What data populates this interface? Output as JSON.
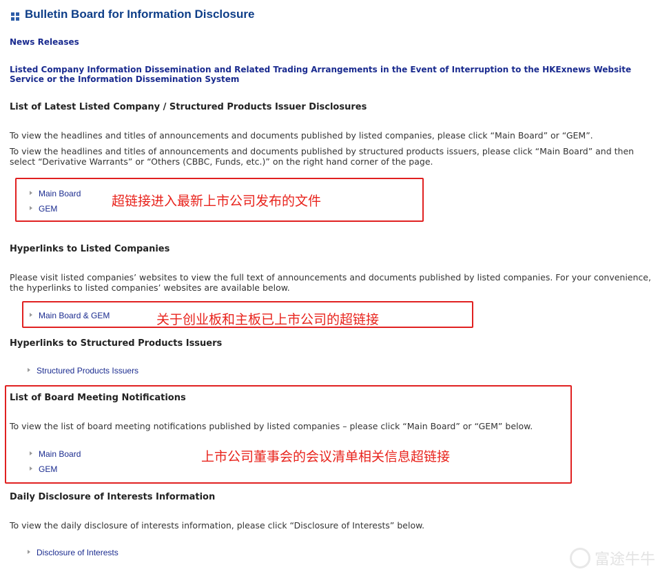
{
  "header": {
    "title": "Bulletin Board for Information Disclosure",
    "icon": "grid-icon"
  },
  "links": {
    "news_releases": "News Releases",
    "dissemination": "Listed Company Information Dissemination and Related Trading Arrangements in the Event of Interruption to the HKExnews Website Service or the Information Dissemination System"
  },
  "sections": {
    "latest": {
      "heading": "List of Latest Listed Company / Structured Products Issuer Disclosures",
      "para1": "To view the headlines and titles of announcements and documents published by listed companies, please click “Main Board” or “GEM”.",
      "para2": "To view the headlines and titles of announcements and documents published by structured products issuers, please click “Main Board” and then select “Derivative Warrants” or “Others (CBBC, Funds, etc.)” on the right hand corner of the page.",
      "items": [
        "Main Board",
        "GEM"
      ],
      "annotation": "超链接进入最新上市公司发布的文件"
    },
    "listed_companies": {
      "heading": "Hyperlinks to Listed Companies",
      "para": "Please visit listed companies’ websites to view the full text of announcements and documents published by listed companies. For your convenience, the hyperlinks to listed companies’ websites are available below.",
      "items": [
        "Main Board & GEM"
      ],
      "annotation": "关于创业板和主板已上市公司的超链接"
    },
    "structured": {
      "heading": "Hyperlinks to Structured Products Issuers",
      "items": [
        "Structured Products Issuers"
      ]
    },
    "board_meeting": {
      "heading": "List of Board Meeting Notifications",
      "para": "To view the list of board meeting notifications published by listed companies – please click “Main Board” or “GEM” below.",
      "items": [
        "Main Board",
        "GEM"
      ],
      "annotation": "上市公司董事会的会议清单相关信息超链接"
    },
    "interests": {
      "heading": "Daily Disclosure of Interests Information",
      "para": "To view the daily disclosure of interests information, please click “Disclosure of Interests” below.",
      "items": [
        "Disclosure of Interests"
      ]
    }
  },
  "watermark": {
    "text": "富途牛牛"
  },
  "colors": {
    "title_blue": "#0e3e88",
    "link_blue": "#1a2b8f",
    "annotation_red": "#e8231c"
  }
}
